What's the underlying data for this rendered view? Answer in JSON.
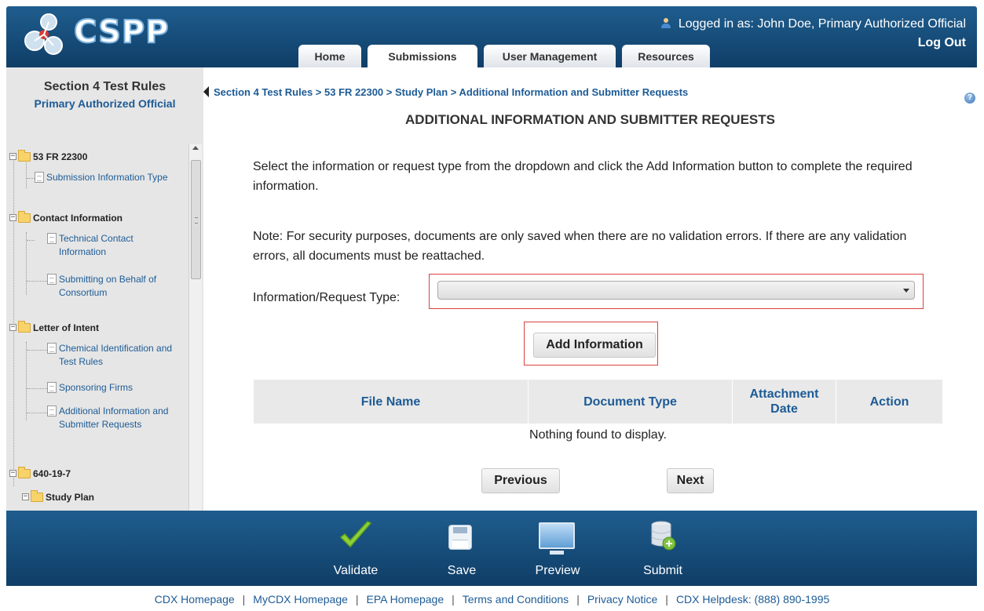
{
  "app": {
    "logo_text": "CSPP",
    "logged_in_prefix": "Logged in as:",
    "logged_in_user": "John Doe, Primary Authorized Official",
    "logout_label": "Log Out"
  },
  "tabs": [
    {
      "label": "Home",
      "active": false
    },
    {
      "label": "Submissions",
      "active": true
    },
    {
      "label": "User Management",
      "active": false
    },
    {
      "label": "Resources",
      "active": false
    }
  ],
  "sidebar": {
    "title": "Section 4 Test Rules",
    "subtitle": "Primary Authorized Official",
    "tree": {
      "root": "53 FR 22300",
      "submission_info": "Submission Information Type",
      "contact_info": "Contact Information",
      "technical_contact": "Technical Contact Information",
      "on_behalf": "Submitting on Behalf of Consortium",
      "letter_of_intent": "Letter of Intent",
      "chem_id": "Chemical Identification and Test Rules",
      "sponsoring": "Sponsoring Firms",
      "additional_info": "Additional Information and Submitter Requests",
      "cas": "640-19-7",
      "study_plan": "Study Plan"
    }
  },
  "main": {
    "breadcrumb": "Section 4 Test Rules > 53 FR 22300 > Study Plan > Additional Information and Submitter Requests",
    "title": "ADDITIONAL INFORMATION AND SUBMITTER REQUESTS",
    "instructions": "Select the information or request type from the dropdown and click the Add Information button to complete the required information.",
    "note": "Note: For security purposes, documents are only saved when there are no validation errors. If there are any validation errors, all documents must be reattached.",
    "request_type_label": "Information/Request Type:",
    "request_type_value": "",
    "add_button": "Add Information",
    "table": {
      "columns": [
        "File Name",
        "Document Type",
        "Attachment Date",
        "Action"
      ],
      "empty_message": "Nothing found to display."
    },
    "prev_button": "Previous",
    "next_button": "Next",
    "help_glyph": "?"
  },
  "toolbar": {
    "validate": "Validate",
    "save": "Save",
    "preview": "Preview",
    "submit": "Submit"
  },
  "footer": {
    "links": [
      "CDX Homepage",
      "MyCDX Homepage",
      "EPA Homepage",
      "Terms and Conditions",
      "Privacy Notice",
      "CDX Helpdesk: (888) 890-1995"
    ]
  },
  "colors": {
    "header_blue": "#1f5d8e",
    "link_blue": "#1d5b96",
    "highlight_red": "#d9433f"
  }
}
